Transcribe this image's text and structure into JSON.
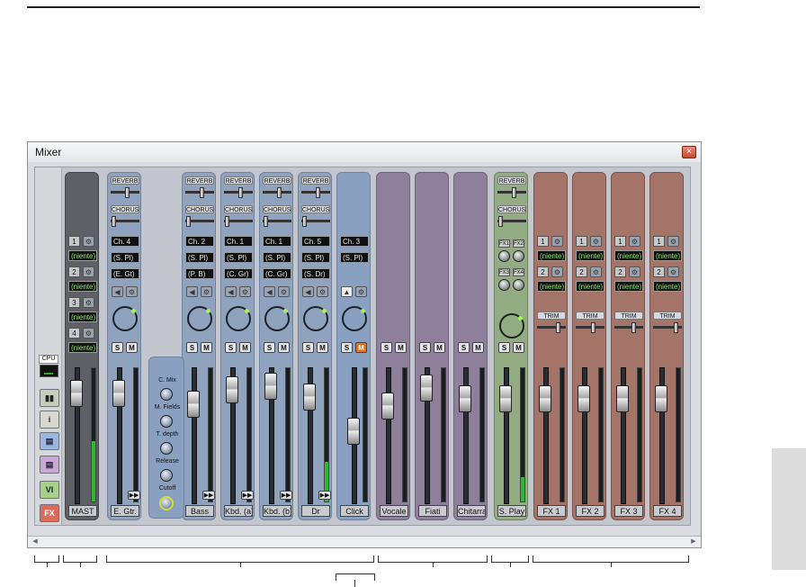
{
  "window": {
    "title": "Mixer",
    "close_glyph": "×"
  },
  "left_toolbar": {
    "cpu_label": "CPU",
    "buttons": [
      {
        "name": "meter-icon",
        "glyph": "▮▮"
      },
      {
        "name": "info-icon",
        "glyph": "i"
      },
      {
        "name": "audio-tracks-icon",
        "glyph": "▤"
      },
      {
        "name": "midi-tracks-icon",
        "glyph": "▤"
      },
      {
        "name": "vi-button",
        "glyph": "VI"
      },
      {
        "name": "fx-button",
        "glyph": "FX"
      }
    ]
  },
  "master": {
    "name": "MAST",
    "inserts": [
      {
        "num": "1",
        "value": "(niente)"
      },
      {
        "num": "2",
        "value": "(niente)"
      },
      {
        "num": "3",
        "value": "(niente)"
      },
      {
        "num": "4",
        "value": "(niente)"
      }
    ]
  },
  "send_labels": {
    "reverb": "REVERB",
    "chorus": "CHORUS"
  },
  "audio_channels": [
    {
      "name": "E. Gtr.",
      "ch": "Ch. 4",
      "mode": "(S. Pl)",
      "preset": "(E. Gt)"
    },
    {
      "name": "Bass",
      "ch": "Ch. 2",
      "mode": "(S. Pl)",
      "preset": "(P. B)"
    },
    {
      "name": "Kbd. (a)",
      "ch": "Ch. 1",
      "mode": "(S. Pl)",
      "preset": "(C. Gr)"
    },
    {
      "name": "Kbd. (b)",
      "ch": "Ch. 1",
      "mode": "(S. Pl)",
      "preset": "(C. Gr)"
    },
    {
      "name": "Dr",
      "ch": "Ch. 5",
      "mode": "(S. Pl)",
      "preset": "(S. Dr)"
    }
  ],
  "click_channel": {
    "name": "Click",
    "ch": "Ch. 3",
    "mode": "(S. Pl)"
  },
  "floater": {
    "labels": [
      "C. Mix",
      "M. Fields",
      "T. depth",
      "Release",
      "Cutoff"
    ]
  },
  "midi_channels": [
    {
      "name": "Vocale"
    },
    {
      "name": "Fiati"
    },
    {
      "name": "Chitarra"
    }
  ],
  "synth_channel": {
    "name": "S. Play",
    "fx_buttons": [
      "FX1",
      "FX2",
      "FX3",
      "FX4"
    ]
  },
  "fx_channels": [
    {
      "name": "FX 1",
      "inserts": [
        {
          "num": "1",
          "value": "(niente)"
        },
        {
          "num": "2",
          "value": "(niente)"
        }
      ],
      "trim": "TRIM"
    },
    {
      "name": "FX 2",
      "inserts": [
        {
          "num": "1",
          "value": "(niente)"
        },
        {
          "num": "2",
          "value": "(niente)"
        }
      ],
      "trim": "TRIM"
    },
    {
      "name": "FX 3",
      "inserts": [
        {
          "num": "1",
          "value": "(niente)"
        },
        {
          "num": "2",
          "value": "(niente)"
        }
      ],
      "trim": "TRIM"
    },
    {
      "name": "FX 4",
      "inserts": [
        {
          "num": "1",
          "value": "(niente)"
        },
        {
          "num": "2",
          "value": "(niente)"
        }
      ],
      "trim": "TRIM"
    }
  ],
  "buttons": {
    "solo": "S",
    "mute": "M"
  },
  "colors": {
    "audio": "#8fa3bf",
    "midi": "#8e7f9a",
    "synth": "#93ac83",
    "fx": "#a57469",
    "master": "#5f6065",
    "mute_active": "#e0741e"
  }
}
